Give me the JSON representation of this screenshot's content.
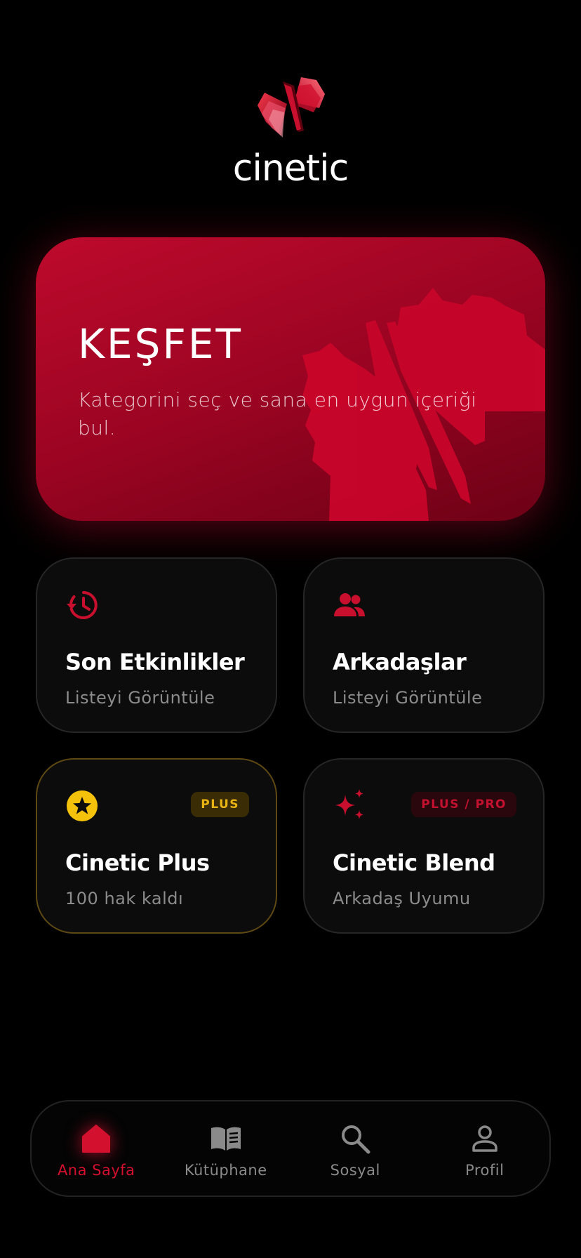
{
  "brand": {
    "name": "cinetic",
    "accent": "#c8102e",
    "gold": "#f5c20b"
  },
  "hero": {
    "title": "KEŞFET",
    "subtitle": "Kategorini seç ve sana en uygun içeriği bul."
  },
  "cards": [
    {
      "title": "Son Etkinlikler",
      "subtitle": "Listeyi Görüntüle",
      "icon": "history-icon"
    },
    {
      "title": "Arkadaşlar",
      "subtitle": "Listeyi Görüntüle",
      "icon": "people-icon"
    },
    {
      "title": "Cinetic Plus",
      "subtitle": "100 hak kaldı",
      "badge": "PLUS",
      "icon": "star-circle-icon"
    },
    {
      "title": "Cinetic Blend",
      "subtitle": "Arkadaş Uyumu",
      "badge": "PLUS / PRO",
      "icon": "sparkles-icon"
    }
  ],
  "nav": [
    {
      "label": "Ana Sayfa",
      "icon": "home-icon",
      "active": true
    },
    {
      "label": "Kütüphane",
      "icon": "book-icon",
      "active": false
    },
    {
      "label": "Sosyal",
      "icon": "search-icon",
      "active": false
    },
    {
      "label": "Profil",
      "icon": "person-icon",
      "active": false
    }
  ]
}
